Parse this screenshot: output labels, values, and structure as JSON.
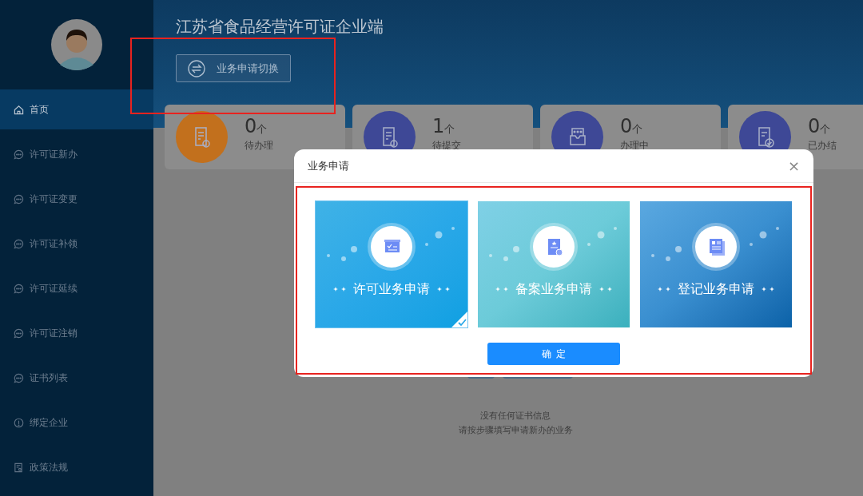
{
  "sidebar": {
    "items": [
      {
        "label": "首页",
        "kind": "home",
        "selected": true
      },
      {
        "label": "许可证新办",
        "kind": "service",
        "selected": false
      },
      {
        "label": "许可证变更",
        "kind": "service",
        "selected": false
      },
      {
        "label": "许可证补领",
        "kind": "service",
        "selected": false
      },
      {
        "label": "许可证延续",
        "kind": "service",
        "selected": false
      },
      {
        "label": "许可证注销",
        "kind": "service",
        "selected": false
      },
      {
        "label": "证书列表",
        "kind": "service",
        "selected": false
      },
      {
        "label": "绑定企业",
        "kind": "binding",
        "selected": false
      },
      {
        "label": "政策法规",
        "kind": "policy",
        "selected": false
      }
    ]
  },
  "header": {
    "title": "江苏省食品经营许可证企业端",
    "switch_button": "业务申请切换"
  },
  "stats": [
    {
      "count": "0",
      "unit": "个",
      "label": "待办理",
      "kind": "pending"
    },
    {
      "count": "1",
      "unit": "个",
      "label": "待提交",
      "kind": "submit"
    },
    {
      "count": "0",
      "unit": "个",
      "label": "办理中",
      "kind": "processing"
    },
    {
      "count": "0",
      "unit": "个",
      "label": "已办结",
      "kind": "done"
    }
  ],
  "empty_state": {
    "line_1": "没有任何证书信息",
    "line_2": "请按步骤填写申请新办的业务"
  },
  "dialog": {
    "title": "业务申请",
    "close": "×",
    "options": [
      {
        "label": "许可业务申请",
        "kind": "permit",
        "selected": true
      },
      {
        "label": "备案业务申请",
        "kind": "filing",
        "selected": false
      },
      {
        "label": "登记业务申请",
        "kind": "registration",
        "selected": false
      }
    ],
    "confirm": "确定"
  }
}
